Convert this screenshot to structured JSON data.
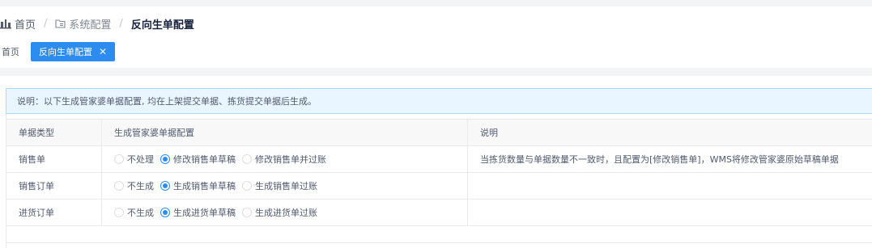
{
  "breadcrumb": {
    "home": "首页",
    "section": "系统配置",
    "current": "反向生单配置",
    "home_icon": "home-icon",
    "section_icon": "folder-icon"
  },
  "tabs": {
    "home_tab": "首页",
    "active_tab": "反向生单配置",
    "close_glyph": "✕"
  },
  "notice": {
    "text": "说明：以下生成管家婆单据配置, 均在上架提交单据、拣货提交单据后生成。"
  },
  "table": {
    "headers": [
      "单据类型",
      "生成管家婆单据配置",
      "说明"
    ],
    "rows": [
      {
        "type": "销售单",
        "options": [
          "不处理",
          "修改销售单草稿",
          "修改销售单并过账"
        ],
        "selected": 1,
        "desc": "当拣货数量与单据数量不一致时，且配置为[修改销售单]，WMS将修改管家婆原始草稿单据"
      },
      {
        "type": "销售订单",
        "options": [
          "不生成",
          "生成销售单草稿",
          "生成销售单过账"
        ],
        "selected": 1,
        "desc": ""
      },
      {
        "type": "进货订单",
        "options": [
          "不生成",
          "生成进货单草稿",
          "生成进货单过账"
        ],
        "selected": 1,
        "desc": ""
      }
    ]
  },
  "colors": {
    "accent": "#2d8cf0",
    "notice_bg": "#eaf6ff",
    "notice_border": "#a8dbff"
  }
}
